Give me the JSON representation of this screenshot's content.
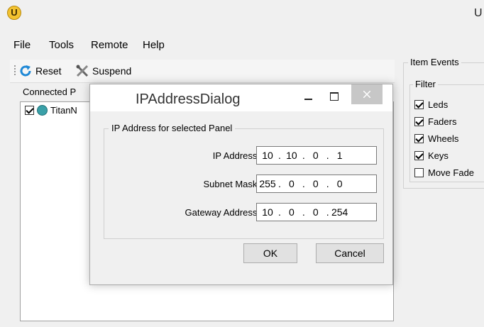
{
  "window": {
    "title": "U"
  },
  "menu": [
    "File",
    "Tools",
    "Remote",
    "Help"
  ],
  "toolbar": {
    "reset_label": "Reset",
    "suspend_label": "Suspend"
  },
  "connected_panels": {
    "label": "Connected P",
    "items": [
      {
        "label": "TitanN",
        "checked": true
      }
    ]
  },
  "item_events": {
    "title": "Item Events",
    "filter_title": "Filter",
    "filters": [
      {
        "label": "Leds",
        "checked": true
      },
      {
        "label": "Faders",
        "checked": true
      },
      {
        "label": "Wheels",
        "checked": true
      },
      {
        "label": "Keys",
        "checked": true
      },
      {
        "label": "Move Fade",
        "checked": false
      }
    ]
  },
  "dialog": {
    "title": "IPAddressDialog",
    "group_title": "IP Address for selected Panel",
    "fields": [
      {
        "label": "IP Address:",
        "octets": [
          "10",
          "10",
          "0",
          "1"
        ]
      },
      {
        "label": "Subnet Mask:",
        "octets": [
          "255",
          "0",
          "0",
          "0"
        ]
      },
      {
        "label": "Gateway Address:",
        "octets": [
          "10",
          "0",
          "0",
          "254"
        ]
      }
    ],
    "ok_label": "OK",
    "cancel_label": "Cancel"
  },
  "colors": {
    "close_button": "#c7c7c7",
    "window_bg": "#f0f0f0",
    "reset_icon": "#1e88d6"
  }
}
